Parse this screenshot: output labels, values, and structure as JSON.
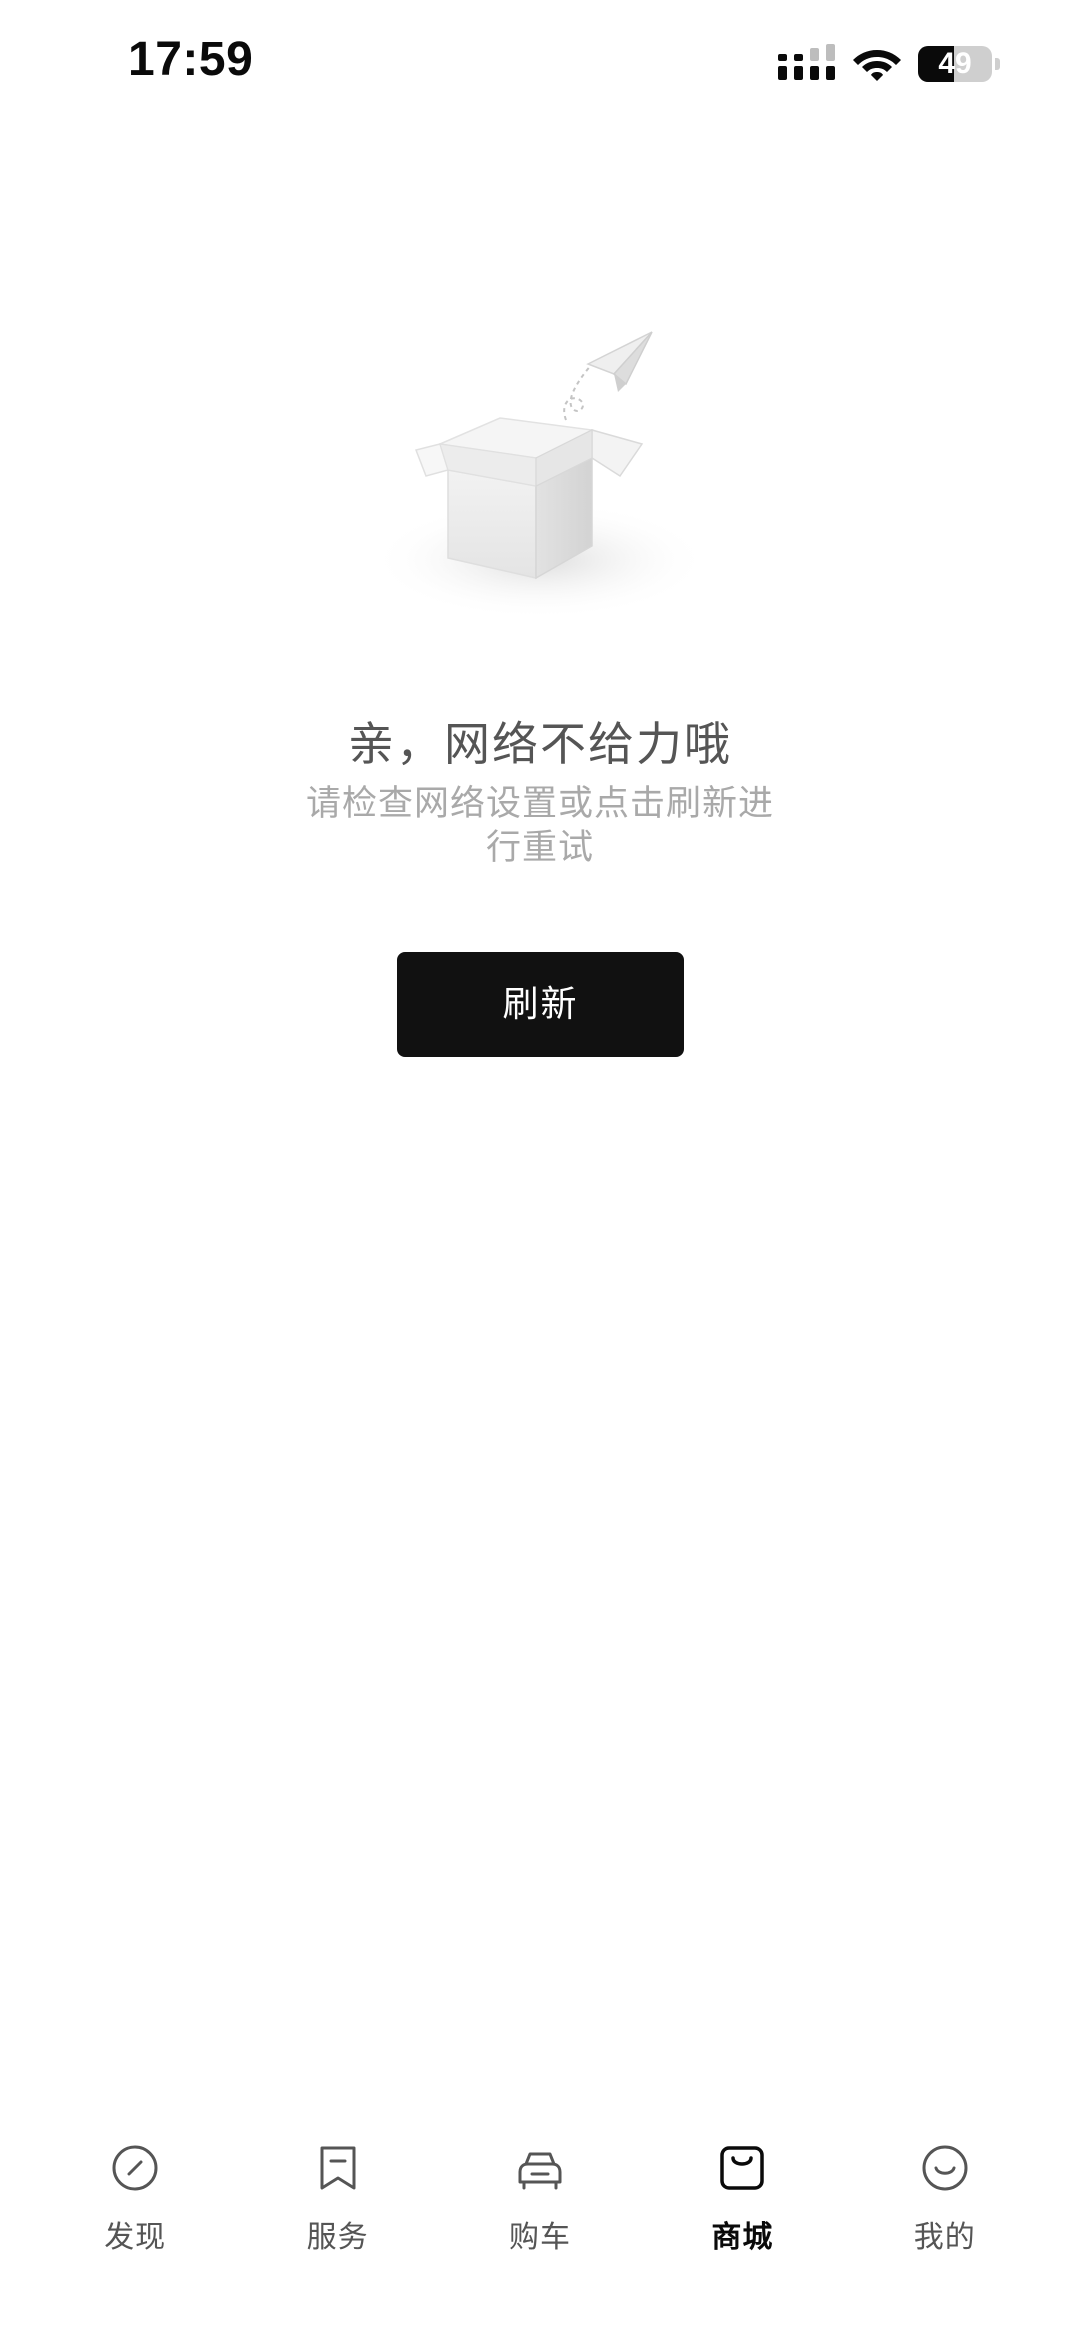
{
  "status_bar": {
    "time": "17:59",
    "battery_level": "49",
    "battery_fraction": 0.49,
    "icons": [
      "cellular-signal-icon",
      "wifi-icon",
      "battery-icon"
    ]
  },
  "empty_state": {
    "illustration": "empty-box-paper-plane-illustration",
    "title": "亲，网络不给力哦",
    "description": "请检查网络设置或点击刷新进行重试",
    "refresh_button_label": "刷新"
  },
  "tab_bar": {
    "active_index": 3,
    "tabs": [
      {
        "label": "发现",
        "icon": "compass-icon"
      },
      {
        "label": "服务",
        "icon": "bookmark-icon"
      },
      {
        "label": "购车",
        "icon": "car-icon"
      },
      {
        "label": "商城",
        "icon": "shopping-bag-icon"
      },
      {
        "label": "我的",
        "icon": "smiley-face-icon"
      }
    ]
  },
  "colors": {
    "background": "#ffffff",
    "button_background": "#111111",
    "title_text": "#555555",
    "desc_text": "#a9a9a9",
    "tab_inactive": "#555555",
    "tab_active": "#0a0a0a"
  }
}
